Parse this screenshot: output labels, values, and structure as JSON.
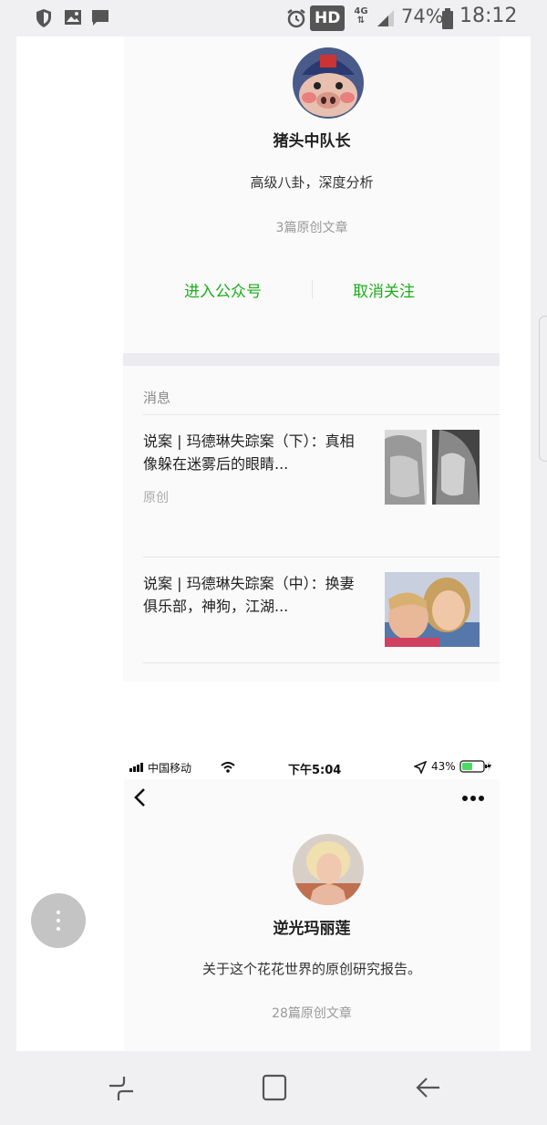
{
  "status_bar": {
    "hd_badge": "HD",
    "network": "4G",
    "battery_percent": "74%",
    "time": "18:12",
    "icons": [
      "shield-icon",
      "gallery-icon",
      "chat-icon",
      "alarm-icon",
      "signal-icon",
      "battery-icon"
    ]
  },
  "profile1": {
    "name": "猪头中队长",
    "description": "高级八卦，深度分析",
    "article_count": "3篇原创文章",
    "enter_label": "进入公众号",
    "unfollow_label": "取消关注"
  },
  "messages": {
    "section_label": "消息",
    "items": [
      {
        "title": "说案 | 玛德琳失踪案（下）：真相像躲在迷雾后的眼睛...",
        "tag": "原创"
      },
      {
        "title": "说案 | 玛德琳失踪案（中）：换妻俱乐部，神狗，江湖...",
        "tag": ""
      }
    ]
  },
  "ios_status": {
    "carrier": "中国移动",
    "time": "下午5:04",
    "battery_percent": "43%"
  },
  "profile2": {
    "name": "逆光玛丽莲",
    "description": "关于这个花花世界的原创研究报告。",
    "article_count": "28篇原创文章"
  },
  "colors": {
    "accent_green": "#1aad19",
    "background": "#f0f0f3"
  }
}
